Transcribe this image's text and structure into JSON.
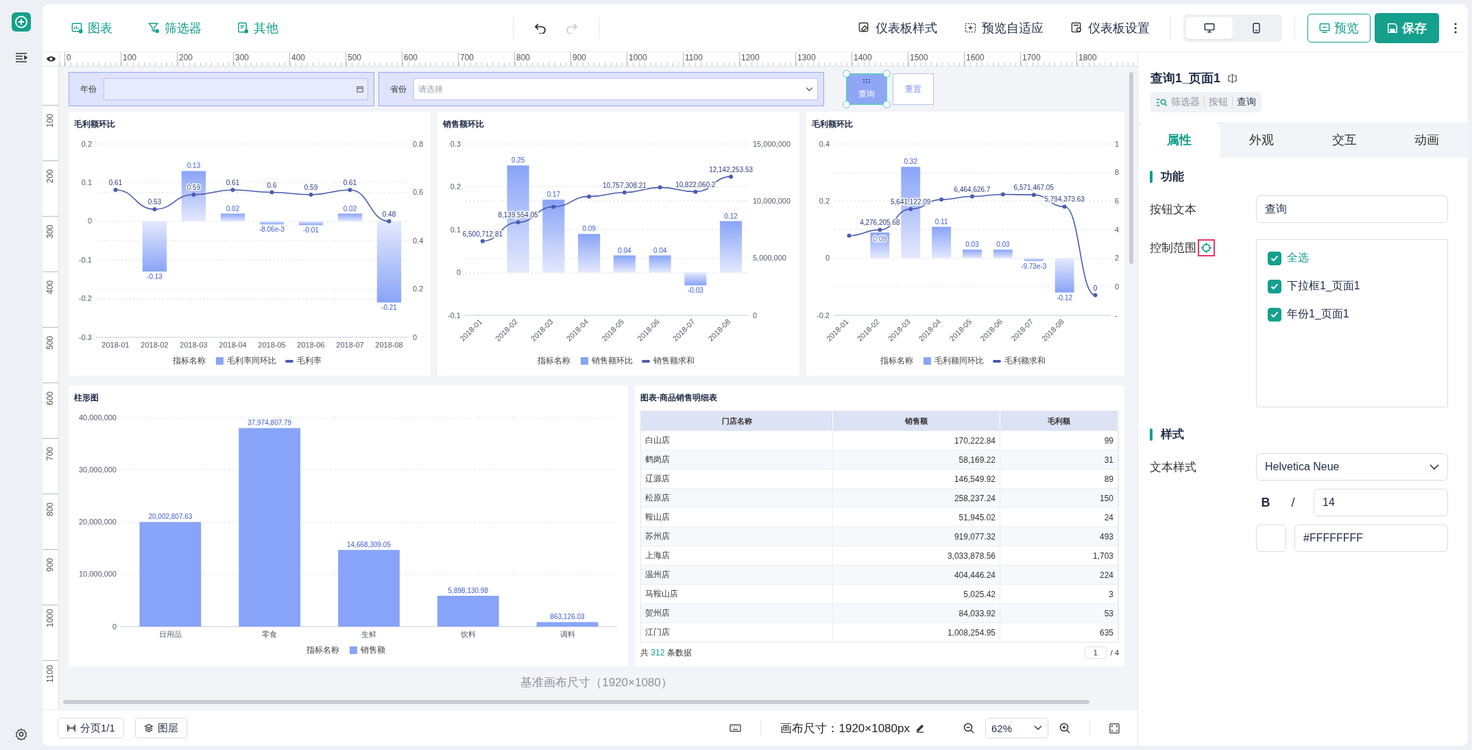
{
  "toolbar": {
    "insert": [
      {
        "label": "图表",
        "kind": "chart"
      },
      {
        "label": "筛选器",
        "kind": "filter"
      },
      {
        "label": "其他",
        "kind": "other"
      }
    ],
    "history": [
      {
        "kind": "undo",
        "disabled": false
      },
      {
        "kind": "redo",
        "disabled": true
      }
    ],
    "actions": [
      {
        "label": "仪表板样式",
        "kind": "style"
      },
      {
        "label": "预览自适应",
        "kind": "fit"
      },
      {
        "label": "仪表板设置",
        "kind": "settings"
      }
    ],
    "devices": [
      {
        "kind": "desktop",
        "selected": true
      },
      {
        "kind": "mobile",
        "selected": false
      }
    ],
    "preview": "预览",
    "save": "保存"
  },
  "ruler": {
    "horizontal": [
      "0",
      "100",
      "200",
      "300",
      "400",
      "500",
      "600",
      "700",
      "800",
      "900",
      "1000",
      "1100",
      "1200",
      "1300",
      "1400",
      "1500",
      "1600",
      "1700",
      "1800"
    ],
    "vertical": [
      "100",
      "200",
      "300",
      "400",
      "500",
      "600",
      "700",
      "800",
      "900",
      "1000",
      "1100"
    ]
  },
  "filters": [
    {
      "kind": "date",
      "label": "年份"
    },
    {
      "kind": "select",
      "label": "省份",
      "placeholder": "请选择"
    }
  ],
  "filter_buttons": [
    {
      "label": "查询",
      "selected": true
    },
    {
      "label": "重置",
      "selected": false
    }
  ],
  "charts": [
    {
      "legend_title": "指标名称",
      "bars": {
        "chart_data": {
          "type": "bar",
          "title": "毛利额环比",
          "grid": true,
          "categories": [
            "2018-01",
            "2018-02",
            "2018-03",
            "2018-04",
            "2018-05",
            "2018-06",
            "2018-07",
            "2018-08"
          ],
          "series": [
            {
              "name": "毛利率同环比",
              "color": "#88a4f8",
              "values": [
                null,
                -0.13,
                0.13,
                0.02,
                -0.00806,
                -0.01,
                0.02,
                -0.21
              ],
              "value_labels": [
                null,
                "-0.13",
                "0.13",
                "0.02",
                "-8.06e-3",
                "-0.01",
                "0.02",
                "-0.21"
              ]
            }
          ],
          "ylim": [
            -0.3,
            0.2
          ],
          "yticks": [
            {
              "value": -0.3,
              "label": "-0.3"
            },
            {
              "value": -0.2,
              "label": "-0.2"
            },
            {
              "value": -0.1,
              "label": "-0.1"
            },
            {
              "value": 0,
              "label": "0"
            },
            {
              "value": 0.1,
              "label": "0.1"
            },
            {
              "value": 0.2,
              "label": "0.2"
            }
          ]
        }
      },
      "line": {
        "chart_data": {
          "type": "line",
          "series": [
            {
              "name": "毛利率",
              "color": "#4a5cb0",
              "marker": true,
              "values": [
                0.61,
                0.53,
                0.59,
                0.61,
                0.6,
                0.59,
                0.61,
                0.48
              ],
              "value_labels": [
                "0.61",
                "0.53",
                "0.59",
                "0.61",
                "0.6",
                "0.59",
                "0.61",
                "0.48"
              ]
            }
          ],
          "ylim": [
            0,
            0.8
          ],
          "yticks": [
            {
              "value": 0,
              "label": "0"
            },
            {
              "value": 0.2,
              "label": "0.2"
            },
            {
              "value": 0.4,
              "label": "0.4"
            },
            {
              "value": 0.6,
              "label": "0.6"
            },
            {
              "value": 0.8,
              "label": "0.8"
            }
          ]
        }
      }
    },
    {
      "legend_title": "指标名称",
      "bars": {
        "chart_data": {
          "type": "bar",
          "title": "销售额环比",
          "grid": true,
          "categories": [
            "2018-01",
            "2018-02",
            "2018-03",
            "2018-04",
            "2018-05",
            "2018-06",
            "2018-07",
            "2018-08"
          ],
          "series": [
            {
              "name": "销售额环比",
              "color": "#88a4f8",
              "values": [
                null,
                0.25,
                0.17,
                0.09,
                0.04,
                0.04,
                -0.03,
                0.12
              ],
              "value_labels": [
                null,
                "0.25",
                "0.17",
                "0.09",
                "0.04",
                "0.04",
                "-0.03",
                "0.12"
              ]
            }
          ],
          "ylim": [
            -0.1,
            0.3
          ],
          "yticks": [
            {
              "value": -0.1,
              "label": "-0.1"
            },
            {
              "value": 0,
              "label": "0"
            },
            {
              "value": 0.1,
              "label": "0.1"
            },
            {
              "value": 0.2,
              "label": "0.2"
            },
            {
              "value": 0.3,
              "label": "0.3"
            }
          ]
        }
      },
      "line": {
        "chart_data": {
          "type": "line",
          "series": [
            {
              "name": "销售额求和",
              "color": "#4a5cb0",
              "marker": true,
              "values": [
                6500712.81,
                8139554.05,
                9500000,
                10400000,
                10757308.21,
                11200000,
                10822060.2,
                12142253.53
              ],
              "value_labels": [
                "6,500,712.81",
                "8,139,554.05",
                null,
                null,
                "10,757,308.21",
                null,
                "10,822,060.2",
                "12,142,253.53"
              ]
            }
          ],
          "ylim": [
            0,
            15000000
          ],
          "yticks": [
            {
              "value": 0,
              "label": "0"
            },
            {
              "value": 5000000,
              "label": "5,000,000"
            },
            {
              "value": 10000000,
              "label": "10,000,000"
            },
            {
              "value": 15000000,
              "label": "15,000,000"
            }
          ]
        }
      }
    },
    {
      "legend_title": "指标名称",
      "bars": {
        "chart_data": {
          "type": "bar",
          "title": "毛利额环比",
          "grid": true,
          "categories": [
            "2018-01",
            "2018-02",
            "2018-03",
            "2018-04",
            "2018-05",
            "2018-06",
            "2018-07",
            "2018-08",
            null
          ],
          "series": [
            {
              "name": "毛利额同环比",
              "color": "#88a4f8",
              "values": [
                null,
                0.09,
                0.32,
                0.11,
                0.03,
                0.03,
                -0.00973,
                -0.12,
                null
              ],
              "value_labels": [
                null,
                "0.09",
                "0.32",
                "0.11",
                "0.03",
                "0.03",
                "-9.73e-3",
                "-0.12",
                null
              ]
            }
          ],
          "ylim": [
            -0.2,
            0.4
          ],
          "yticks": [
            {
              "value": -0.2,
              "label": "-0.2"
            },
            {
              "value": 0,
              "label": "0"
            },
            {
              "value": 0.2,
              "label": "0.2"
            },
            {
              "value": 0.4,
              "label": "0.4"
            }
          ]
        }
      },
      "line": {
        "axis_labels": [
          "1",
          "8",
          "6",
          "4",
          "2",
          "0",
          "-"
        ],
        "chart_data": {
          "type": "line",
          "series": [
            {
              "name": "毛利额求和",
              "color": "#4a5cb0",
              "marker": true,
              "values": [
                3900000,
                4276205.68,
                5641122.09,
                6260000,
                6464626.7,
                6600000,
                6571467.05,
                5794373.63,
                0
              ],
              "value_labels": [
                null,
                "4,276,205.68",
                "5,641,122.09",
                null,
                "6,464,626.7",
                null,
                "6,571,467.05",
                "5,794,373.63",
                "0"
              ]
            }
          ]
        }
      }
    }
  ],
  "bar_chart": {
    "legend_title": "指标名称",
    "bars": {
      "chart_data": {
        "type": "bar",
        "title": "柱形图",
        "grid": true,
        "categories": [
          "日用品",
          "零食",
          "生鲜",
          "饮料",
          "调料"
        ],
        "series": [
          {
            "name": "销售额",
            "color": "#88a4f8",
            "values": [
              20002807.63,
              37974807.79,
              14668309.05,
              5898130.98,
              863126.03
            ],
            "value_labels": [
              "20,002,807.63",
              "37,974,807.79",
              "14,668,309.05",
              "5,898,130.98",
              "863,126.03"
            ]
          }
        ],
        "ylim": [
          0,
          40000000
        ],
        "yticks": [
          {
            "value": 0,
            "label": "0"
          },
          {
            "value": 10000000,
            "label": "10,000,000"
          },
          {
            "value": 20000000,
            "label": "20,000,000"
          },
          {
            "value": 30000000,
            "label": "30,000,000"
          },
          {
            "value": 40000000,
            "label": "40,000,000"
          }
        ]
      }
    }
  },
  "table": {
    "title": "图表-商品销售明细表",
    "columns": [
      "门店名称",
      "销售额",
      "毛利额"
    ],
    "rows": [
      [
        "白山店",
        "170,222.84",
        "99"
      ],
      [
        "鹤岗店",
        "58,169.22",
        "31"
      ],
      [
        "辽源店",
        "146,549.92",
        "89"
      ],
      [
        "松原店",
        "258,237.24",
        "150"
      ],
      [
        "鞍山店",
        "51,945.02",
        "24"
      ],
      [
        "苏州店",
        "919,077.32",
        "493"
      ],
      [
        "上海店",
        "3,033,878.56",
        "1,703"
      ],
      [
        "温州店",
        "404,446.24",
        "224"
      ],
      [
        "马鞍山店",
        "5,025.42",
        "3"
      ],
      [
        "贺州店",
        "84,033.92",
        "53"
      ],
      [
        "江门店",
        "1,008,254.95",
        "635"
      ]
    ],
    "footer": {
      "prefix": "共",
      "count": "312",
      "suffix": "条数据"
    },
    "page": "1",
    "pages": "/ 4"
  },
  "canvas_caption": "基准画布尺寸（1920×1080）",
  "bottom_bar": {
    "pages": "分页1/1",
    "layers": "图层",
    "canvas_size": "画布尺寸：1920×1080px",
    "zoom": "62%"
  },
  "panel": {
    "title": "查询1_页面1",
    "breadcrumb": [
      "筛选器",
      "按钮",
      "查询"
    ],
    "tabs": [
      {
        "label": "属性",
        "selected": true
      },
      {
        "label": "外观",
        "selected": false
      },
      {
        "label": "交互",
        "selected": false
      },
      {
        "label": "动画",
        "selected": false
      }
    ],
    "function_heading": "功能",
    "button_text_label": "按钮文本",
    "button_text": "查询",
    "scope": {
      "label": "控制范围",
      "highlighted": true,
      "options": [
        {
          "label": "全选",
          "kind": "all",
          "checked": true
        },
        {
          "label": "下拉框1_页面1",
          "kind": "item",
          "checked": true
        },
        {
          "label": "年份1_页面1",
          "kind": "item",
          "checked": true
        }
      ]
    },
    "style_heading": "样式",
    "text_style_label": "文本样式",
    "font": "Helvetica Neue",
    "bold": "B",
    "italic": "/",
    "size": "14",
    "color_value": "#FFFFFFFF"
  }
}
